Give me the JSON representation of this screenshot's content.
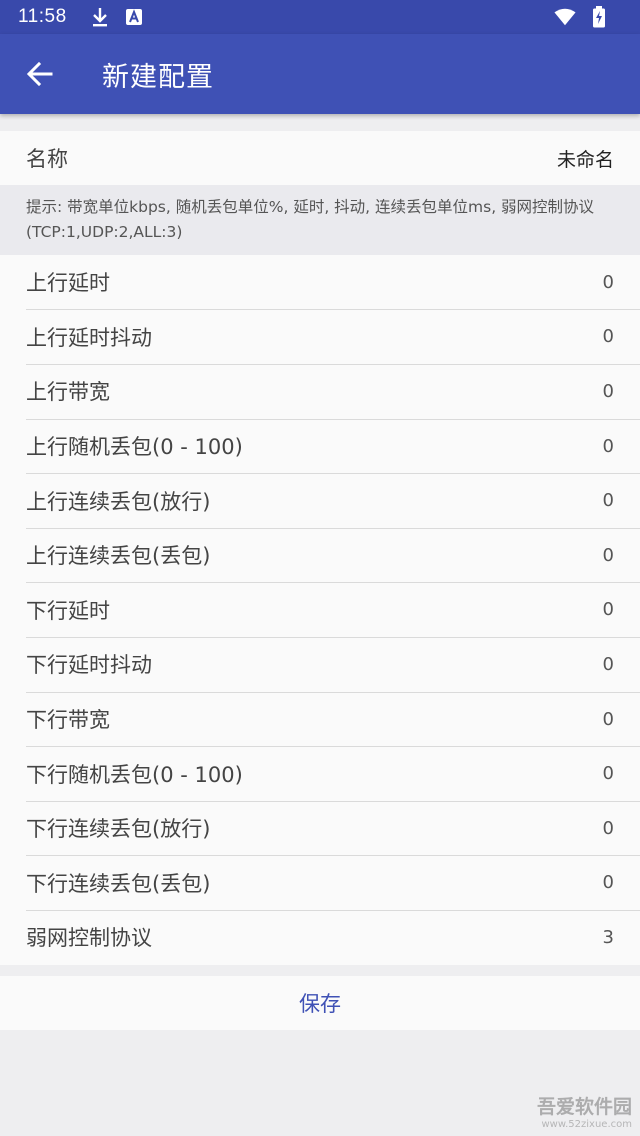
{
  "status_bar": {
    "time": "11:58",
    "icons": [
      "download-icon",
      "notification-a-icon",
      "wifi-icon",
      "battery-charging-icon"
    ]
  },
  "app_bar": {
    "title": "新建配置",
    "back_icon": "arrow-left-icon"
  },
  "name_field": {
    "label": "名称",
    "value": "未命名"
  },
  "hint": "提示: 带宽单位kbps, 随机丢包单位%, 延时, 抖动, 连续丢包单位ms, 弱网控制协议(TCP:1,UDP:2,ALL:3)",
  "settings": [
    {
      "label": "上行延时",
      "value": "0"
    },
    {
      "label": "上行延时抖动",
      "value": "0"
    },
    {
      "label": "上行带宽",
      "value": "0"
    },
    {
      "label": "上行随机丢包(0 - 100)",
      "value": "0"
    },
    {
      "label": "上行连续丢包(放行)",
      "value": "0"
    },
    {
      "label": "上行连续丢包(丢包)",
      "value": "0"
    },
    {
      "label": "下行延时",
      "value": "0"
    },
    {
      "label": "下行延时抖动",
      "value": "0"
    },
    {
      "label": "下行带宽",
      "value": "0"
    },
    {
      "label": "下行随机丢包(0 - 100)",
      "value": "0"
    },
    {
      "label": "下行连续丢包(放行)",
      "value": "0"
    },
    {
      "label": "下行连续丢包(丢包)",
      "value": "0"
    },
    {
      "label": "弱网控制协议",
      "value": "3"
    }
  ],
  "save_label": "保存",
  "watermark": {
    "main": "吾爱软件园",
    "sub": "www.52zixue.com"
  },
  "colors": {
    "status_bar": "#3949ab",
    "app_bar": "#3f51b5",
    "accent": "#3f51b5",
    "background": "#eeeef0"
  }
}
